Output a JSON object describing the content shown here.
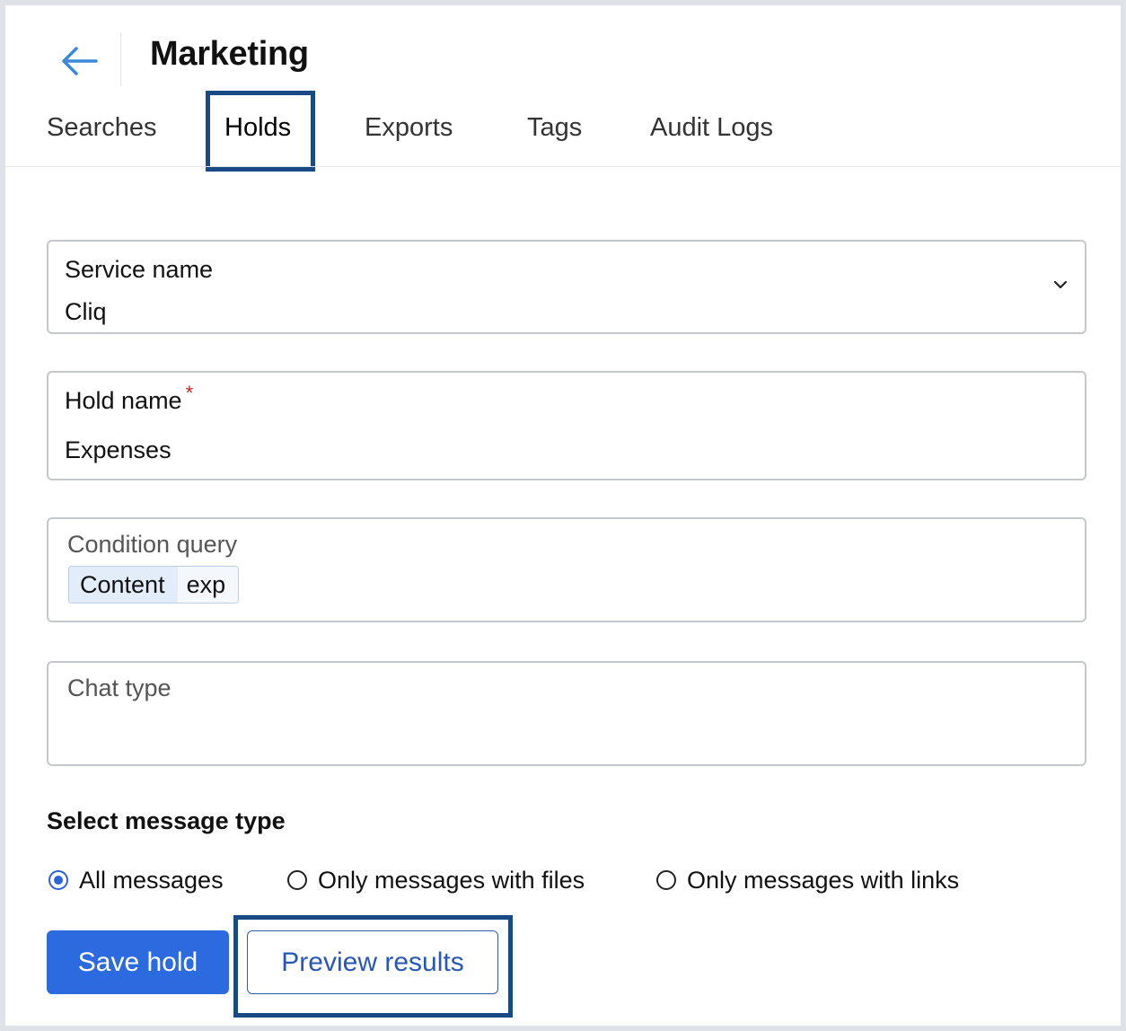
{
  "header": {
    "back_icon": "arrow-left-icon",
    "title": "Marketing"
  },
  "tabs": [
    {
      "label": "Searches",
      "active": false
    },
    {
      "label": "Holds",
      "active": true
    },
    {
      "label": "Exports",
      "active": false
    },
    {
      "label": "Tags",
      "active": false
    },
    {
      "label": "Audit Logs",
      "active": false
    }
  ],
  "form": {
    "service": {
      "label": "Service name",
      "value": "Cliq",
      "icon": "chevron-down-icon"
    },
    "hold_name": {
      "label": "Hold name",
      "required_mark": "*",
      "value": "Expenses"
    },
    "condition": {
      "label": "Condition query",
      "chip_key": "Content",
      "chip_value": "exp"
    },
    "chat_type": {
      "label": "Chat type",
      "value": ""
    }
  },
  "message_type": {
    "title": "Select message type",
    "options": [
      {
        "label": "All messages",
        "selected": true
      },
      {
        "label": "Only messages with files",
        "selected": false
      },
      {
        "label": "Only messages with links",
        "selected": false
      }
    ]
  },
  "actions": {
    "save_label": "Save hold",
    "preview_label": "Preview results"
  },
  "colors": {
    "primary": "#2c6ae0",
    "highlight_border": "#1a4a85",
    "required": "#d21f1f"
  }
}
